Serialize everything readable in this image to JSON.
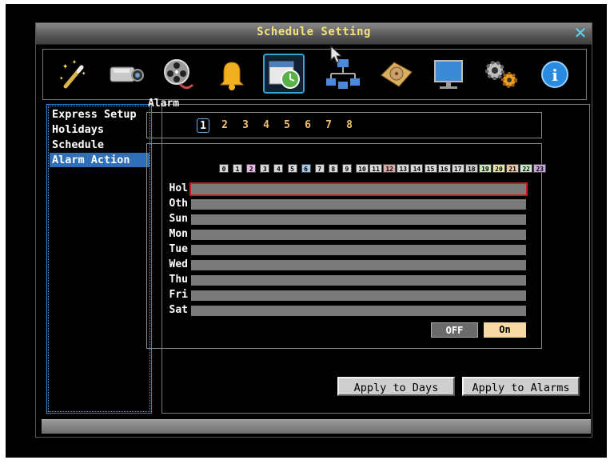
{
  "window": {
    "title": "Schedule Setting"
  },
  "toolbar": {
    "tools": [
      {
        "name": "wizard-icon"
      },
      {
        "name": "camera-icon"
      },
      {
        "name": "film-reel-icon"
      },
      {
        "name": "bell-icon"
      },
      {
        "name": "schedule-icon",
        "active": true
      },
      {
        "name": "network-icon"
      },
      {
        "name": "hard-disk-icon"
      },
      {
        "name": "monitor-icon"
      },
      {
        "name": "gears-icon"
      },
      {
        "name": "info-icon"
      }
    ]
  },
  "sidebar": {
    "items": [
      {
        "label": "Express Setup"
      },
      {
        "label": "Holidays"
      },
      {
        "label": "Schedule"
      },
      {
        "label": "Alarm Action",
        "selected": true
      }
    ]
  },
  "alarm": {
    "label": "Alarm",
    "numbers": [
      "1",
      "2",
      "3",
      "4",
      "5",
      "6",
      "7",
      "8"
    ],
    "selected": "1"
  },
  "schedule": {
    "hours": [
      "0",
      "1",
      "2",
      "3",
      "4",
      "5",
      "6",
      "7",
      "8",
      "9",
      "10",
      "11",
      "12",
      "13",
      "14",
      "15",
      "16",
      "17",
      "18",
      "19",
      "20",
      "21",
      "22",
      "23"
    ],
    "hour_colors": [
      "#d8d8d8",
      "#d8d8d8",
      "#e6b8e6",
      "#d8d8d8",
      "#d8d8d8",
      "#d8d8d8",
      "#a8c8e8",
      "#d8d8d8",
      "#d8d8d8",
      "#d8d8d8",
      "#d8d8d8",
      "#d8d8d8",
      "#d8a8a8",
      "#d8d8d8",
      "#d8d8d8",
      "#d8d8d8",
      "#d8d8d8",
      "#d8d8d8",
      "#c8c8c8",
      "#c8e8b8",
      "#e8e8a8",
      "#e8c8a8",
      "#c8e8c8",
      "#c8a8d8"
    ],
    "days": [
      "Hol",
      "Oth",
      "Sun",
      "Mon",
      "Tue",
      "Wed",
      "Thu",
      "Fri",
      "Sat"
    ],
    "selected_day": "Hol"
  },
  "buttons": {
    "off": "OFF",
    "on": "On",
    "apply_days": "Apply to Days",
    "apply_alarms": "Apply to Alarms"
  },
  "colors": {
    "title_text": "#f4e27a",
    "selection": "#2f6fb7",
    "on_button": "#f7d9a4",
    "day_bar": "#7a7a7a"
  }
}
